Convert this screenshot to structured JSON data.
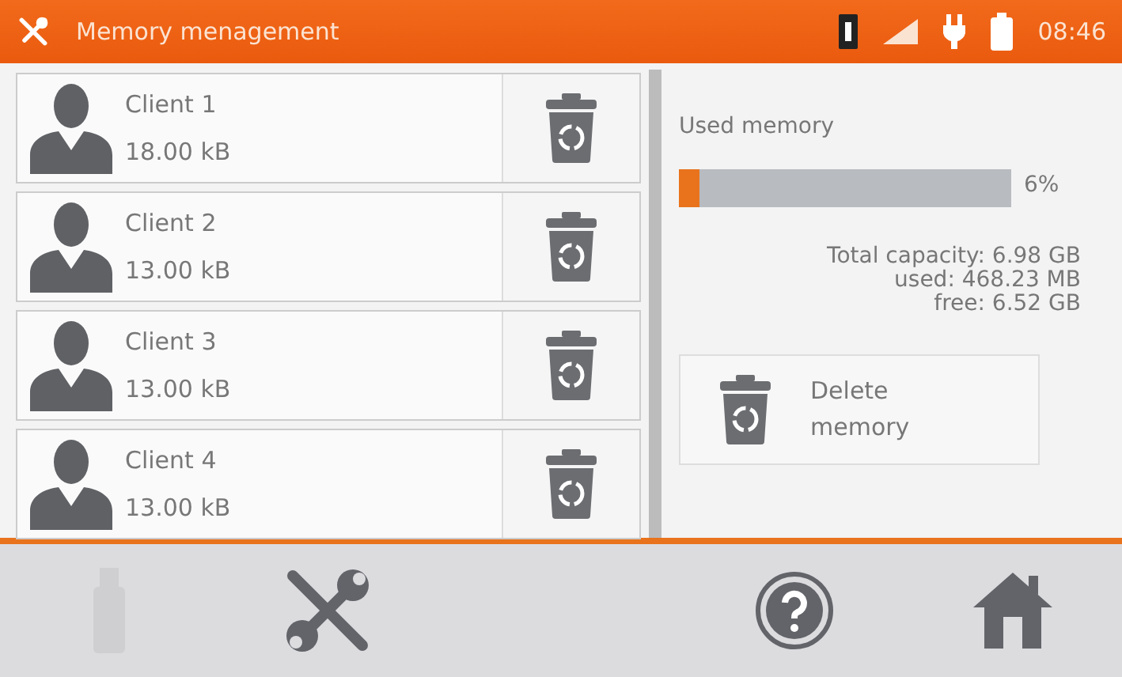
{
  "header": {
    "title": "Memory menagement",
    "time": "08:46"
  },
  "clients": [
    {
      "name": "Client 1",
      "size": "18.00 kB"
    },
    {
      "name": "Client 2",
      "size": "13.00 kB"
    },
    {
      "name": "Client 3",
      "size": "13.00 kB"
    },
    {
      "name": "Client 4",
      "size": "13.00 kB"
    }
  ],
  "memory": {
    "label": "Used memory",
    "level": 0.06,
    "percent": "6%",
    "stats": [
      {
        "label": "Total capacity:",
        "value": "6.98 GB"
      },
      {
        "label": "used:",
        "value": "468.23 MB"
      },
      {
        "label": "free:",
        "value": "6.52 GB"
      }
    ],
    "delete_button": "Delete memory"
  },
  "toolbar": [
    {
      "kind": "usb",
      "disabled": true
    },
    {
      "kind": "tools",
      "disabled": false
    },
    {
      "kind": "help",
      "disabled": false
    },
    {
      "kind": "home",
      "disabled": false
    }
  ]
}
